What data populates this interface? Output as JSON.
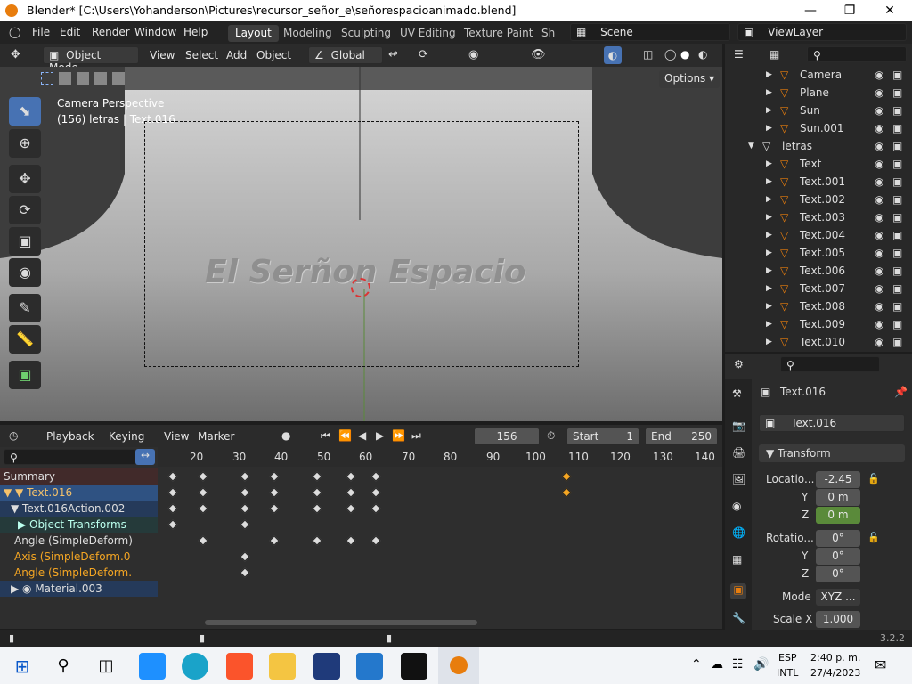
{
  "window": {
    "title": "Blender* [C:\\Users\\Yohanderson\\Pictures\\recursor_señor_e\\señorespacioanimado.blend]"
  },
  "colors": {
    "accent": "#4772b3",
    "keyframe_selected": "#f5a623",
    "object_orange": "#e87d0d",
    "green_field": "#5a8a3a"
  },
  "topbar": {
    "menus": [
      "File",
      "Edit",
      "Render",
      "Window",
      "Help"
    ],
    "workspaces": [
      "Layout",
      "Modeling",
      "Sculpting",
      "UV Editing",
      "Texture Paint",
      "Sh"
    ],
    "scene": "Scene",
    "view_layer": "ViewLayer"
  },
  "viewport_header": {
    "mode": "Object Mode",
    "menus": [
      "View",
      "Select",
      "Add",
      "Object"
    ],
    "orientation": "Global",
    "options": "Options"
  },
  "viewport": {
    "overlay_title": "Camera Perspective",
    "overlay_sub": "(156) letras | Text.016",
    "scene_text": "El Serñon Espacio"
  },
  "timeline": {
    "menus": [
      "Playback",
      "Keying",
      "View",
      "Marker"
    ],
    "current_frame": "156",
    "start_label": "Start",
    "start": "1",
    "end_label": "End",
    "end": "250",
    "ruler": [
      "20",
      "30",
      "40",
      "50",
      "60",
      "70",
      "80",
      "90",
      "100",
      "110",
      "120",
      "130",
      "140"
    ],
    "channels": [
      {
        "label": "Summary"
      },
      {
        "label": "Text.016"
      },
      {
        "label": "Text.016Action.002"
      },
      {
        "label": "Object Transforms"
      },
      {
        "label": "Angle (SimpleDeform)"
      },
      {
        "label": "Axis (SimpleDeform.0"
      },
      {
        "label": "Angle (SimpleDeform."
      },
      {
        "label": "Material.003"
      }
    ]
  },
  "outliner": {
    "items": [
      {
        "label": "Camera"
      },
      {
        "label": "Plane"
      },
      {
        "label": "Sun"
      },
      {
        "label": "Sun.001"
      },
      {
        "label": "letras"
      },
      {
        "label": "Text"
      },
      {
        "label": "Text.001"
      },
      {
        "label": "Text.002"
      },
      {
        "label": "Text.003"
      },
      {
        "label": "Text.004"
      },
      {
        "label": "Text.005"
      },
      {
        "label": "Text.006"
      },
      {
        "label": "Text.007"
      },
      {
        "label": "Text.008"
      },
      {
        "label": "Text.009"
      },
      {
        "label": "Text.010"
      }
    ]
  },
  "properties": {
    "object_name": "Text.016",
    "object_field": "Text.016",
    "section": "Transform",
    "location_label": "Locatio...",
    "loc_x": "-2.45",
    "y_label": "Y",
    "loc_y": "0 m",
    "z_label": "Z",
    "loc_z": "0 m",
    "rotation_label": "Rotatio...",
    "rot_x": "0°",
    "rot_y": "0°",
    "rot_z": "0°",
    "mode_label": "Mode",
    "mode_value": "XYZ ...",
    "scale_label": "Scale X",
    "scale_x": "1.000"
  },
  "statusbar": {
    "version": "3.2.2"
  },
  "taskbar": {
    "lang1": "ESP",
    "lang2": "INTL",
    "time": "2:40 p. m.",
    "date": "27/4/2023"
  }
}
